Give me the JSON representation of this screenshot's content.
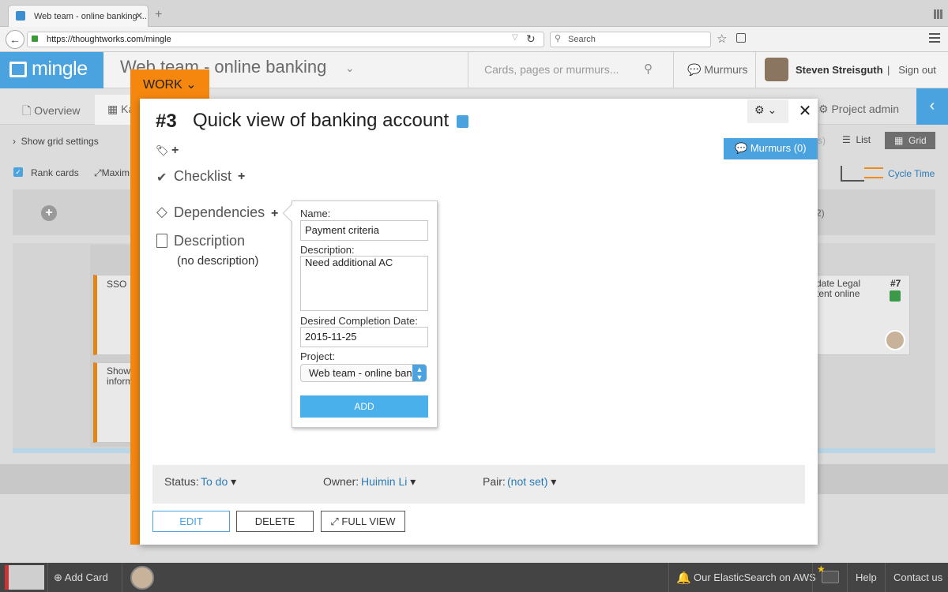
{
  "browser": {
    "tab_title": "Web team - online banking ...",
    "url": "https://thoughtworks.com/mingle",
    "search_placeholder": "Search"
  },
  "header": {
    "logo": "mingle",
    "project": "Web team - online banking",
    "search_placeholder": "Cards, pages or murmurs...",
    "murmurs": "Murmurs",
    "user": "Steven Streisguth",
    "sign_out": "Sign out"
  },
  "nav": {
    "overview": "Overview",
    "kanban_partial": "Ka",
    "project_admin": "Project admin"
  },
  "board": {
    "show_grid_settings": "Show grid settings",
    "rank_cards": "Rank cards",
    "maximize_partial": "Maxim",
    "view_partial": "s)",
    "list": "List",
    "grid": "Grid",
    "cycle_time": "Cycle Time",
    "lane_count_partial": "2)",
    "cards": [
      {
        "text": "SSO"
      },
      {
        "text": "Show\ninform"
      }
    ],
    "card7": {
      "text": "date Legal\ntent online",
      "number": "#7"
    }
  },
  "modal": {
    "tab": "WORK",
    "number": "#3",
    "title": "Quick view of banking account",
    "murmurs_button": "Murmurs (0)",
    "checklist": "Checklist",
    "dependencies": "Dependencies",
    "description": "Description",
    "no_description": "(no description)",
    "properties": {
      "status_label": "Status:",
      "status_value": "To do",
      "owner_label": "Owner:",
      "owner_value": "Huimin Li",
      "pair_label": "Pair:",
      "pair_value": "(not set)"
    },
    "buttons": {
      "edit": "EDIT",
      "delete": "DELETE",
      "full_view": "FULL VIEW"
    }
  },
  "dependency_form": {
    "name_label": "Name:",
    "name_value": "Payment criteria",
    "description_label": "Description:",
    "description_value": "Need additional AC",
    "date_label": "Desired Completion Date:",
    "date_value": "2015-11-25",
    "project_label": "Project:",
    "project_value": "Web team - online banking",
    "add": "ADD"
  },
  "footer": {
    "add_card": "Add Card",
    "elastic": "Our ElasticSearch on AWS",
    "help": "Help",
    "contact": "Contact us"
  },
  "colors": {
    "accent": "#4aa3df",
    "work": "#f5870f"
  }
}
